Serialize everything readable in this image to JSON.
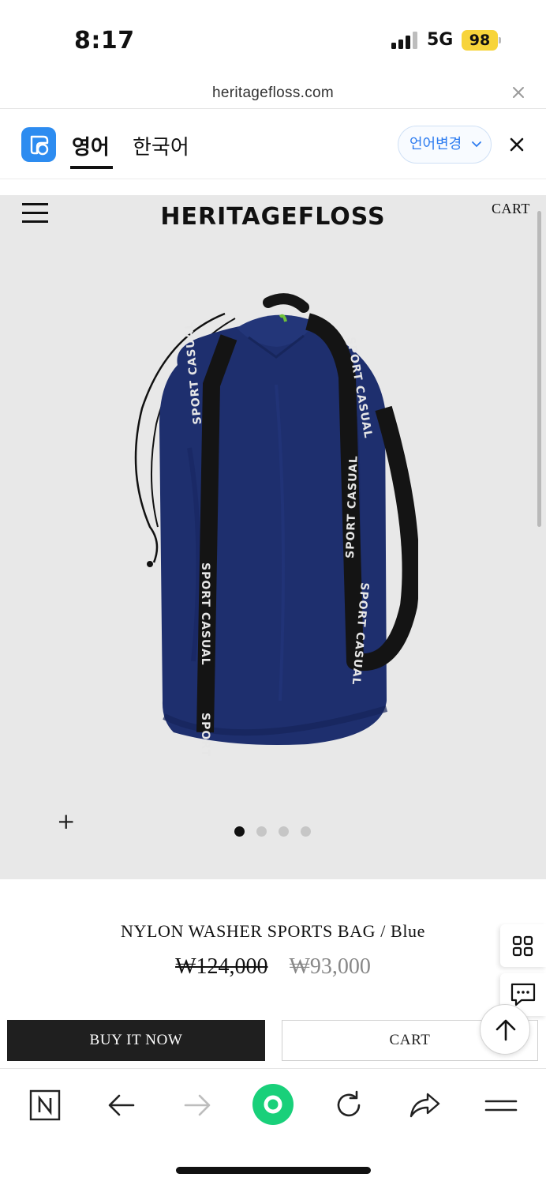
{
  "status_bar": {
    "time": "8:17",
    "network": "5G",
    "battery": "98"
  },
  "url_bar": {
    "domain": "heritagefloss.com"
  },
  "translate_bar": {
    "tabs": [
      {
        "label": "영어"
      },
      {
        "label": "한국어"
      }
    ],
    "change_language": "언어변경"
  },
  "header": {
    "brand": "HERITAGEFLOSS",
    "cart": "CART"
  },
  "gallery": {
    "image_count": 4,
    "active_index": 0,
    "zoom_label": "+"
  },
  "product": {
    "name": "NYLON WASHER SPORTS BAG / Blue",
    "original_price": "₩124,000",
    "sale_price": "₩93,000",
    "strap_text": "SPORT CASUAL",
    "color": "#1e2f6e"
  },
  "actions": {
    "buy_now": "BUY IT NOW",
    "cart": "CART"
  },
  "colors": {
    "accent_blue": "#2d8cf0",
    "battery": "#f7d43a",
    "toolbar_green": "#19d07a"
  }
}
